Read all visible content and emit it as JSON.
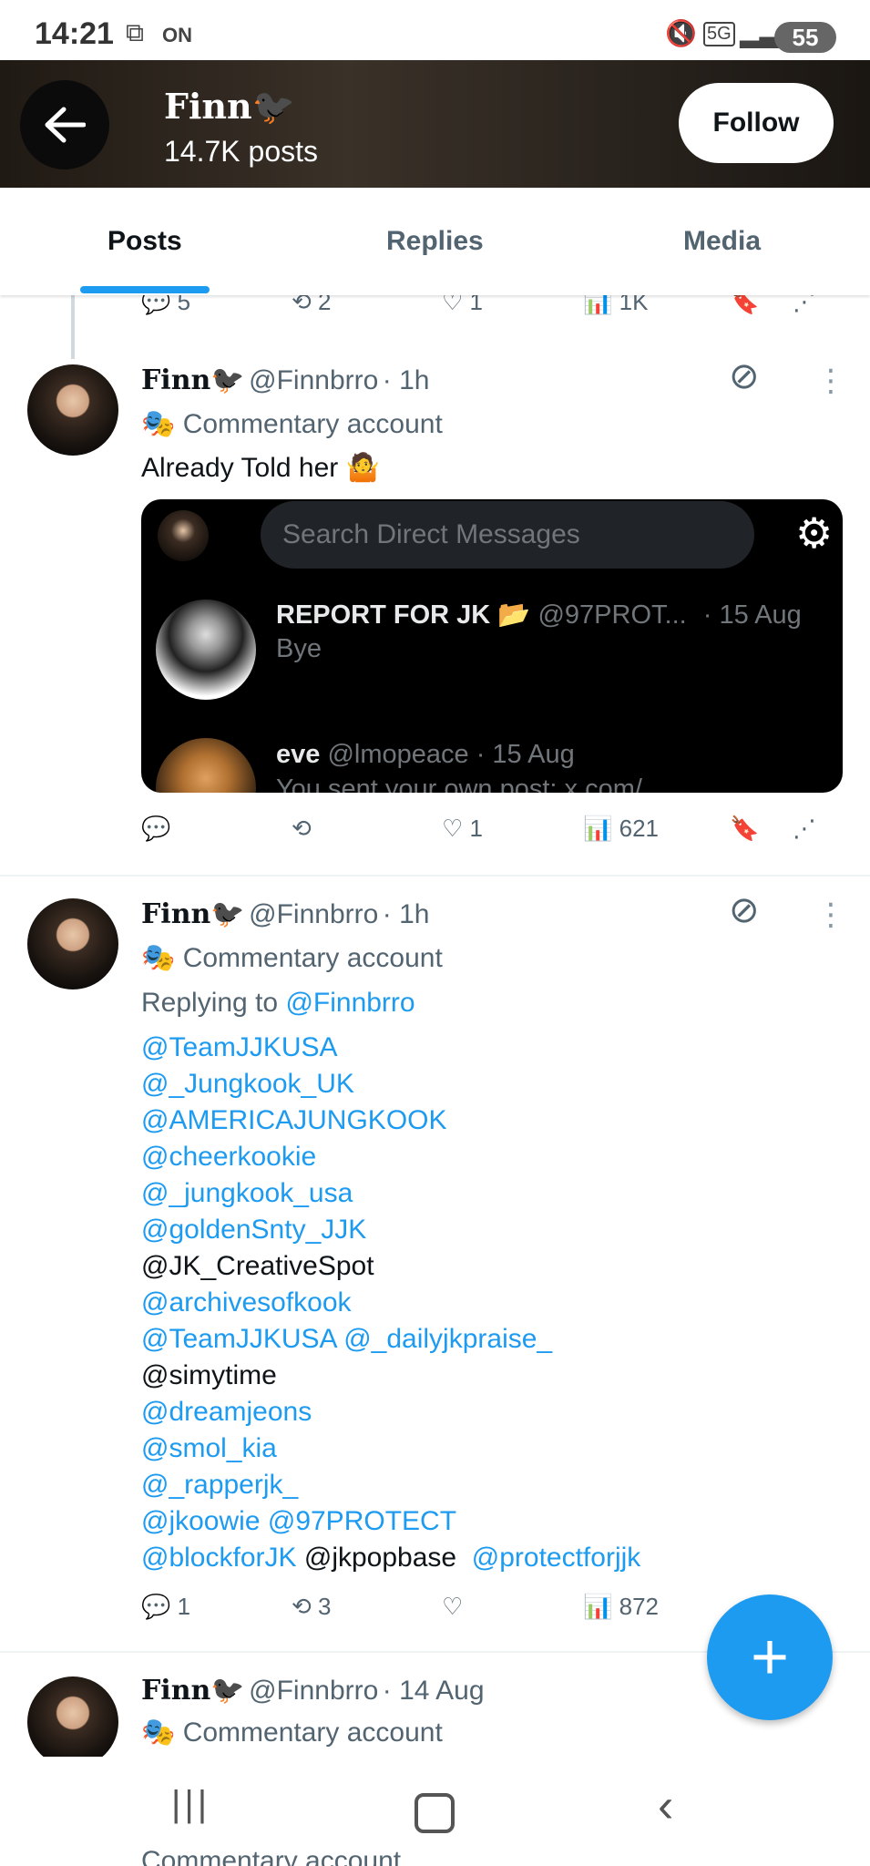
{
  "status_bar": {
    "time": "14:21",
    "nfc": "ON",
    "network": "5G",
    "battery": "55"
  },
  "header": {
    "name": "Finn🐦‍⬛",
    "posts": "14.7K posts",
    "follow_label": "Follow"
  },
  "tabs": [
    {
      "label": "Posts"
    },
    {
      "label": "Replies"
    },
    {
      "label": "Media"
    }
  ],
  "prev_actions": {
    "replies": "5",
    "reposts": "2",
    "likes": "1",
    "views": "1K"
  },
  "post1": {
    "name": "Finn🐦‍⬛",
    "handle": "@Finnbrro",
    "time": "· 1h",
    "label": "Commentary account",
    "text": "Already Told her 🤷",
    "card": {
      "search_placeholder": "Search Direct Messages",
      "dm1": {
        "name": "REPORT FOR JK 📂",
        "handle": "@97PROT...",
        "date": "· 15 Aug",
        "message": "Bye"
      },
      "dm2": {
        "name": "eve",
        "handle": "@lmopeace",
        "date": "· 15 Aug",
        "message": "You sent your own post: x.com/"
      }
    },
    "actions": {
      "replies": "",
      "reposts": "",
      "likes": "1",
      "views": "621"
    }
  },
  "post2": {
    "name": "Finn🐦‍⬛",
    "handle": "@Finnbrro",
    "time": "· 1h",
    "label": "Commentary account",
    "replying_prefix": "Replying to",
    "replying_to": "@Finnbrro",
    "lines": [
      [
        "@TeamJJKUSA"
      ],
      [
        "@_Jungkook_UK"
      ],
      [
        "@AMERICAJUNGKOOK"
      ],
      [
        "@cheerkookie"
      ],
      [
        "@_jungkook_usa"
      ],
      [
        "@goldenSnty_JJK"
      ],
      [
        "@JK_CreativeSpot"
      ],
      [
        "@archivesofkook"
      ],
      [
        "@TeamJJKUSA",
        "@_dailyjkpraise_"
      ],
      [
        "@simytime"
      ],
      [
        "@dreamjeons"
      ],
      [
        "@smol_kia"
      ],
      [
        "@_rapperjk_"
      ],
      [
        "@jkoowie",
        "@97PROTECT"
      ],
      [
        "@blockforJK",
        "@jkpopbase",
        "@protectforjjk"
      ]
    ],
    "actions": {
      "replies": "1",
      "reposts": "3",
      "likes": "",
      "views": "872"
    }
  },
  "post3": {
    "name": "Finn🐦‍⬛",
    "handle": "@Finnbrro",
    "time": "· 14 Aug",
    "label": "Commentary account"
  },
  "peek_label": "Commentary account",
  "colors": {
    "accent": "#1d9bf0",
    "text": "#0f1419",
    "secondary": "#536471"
  }
}
